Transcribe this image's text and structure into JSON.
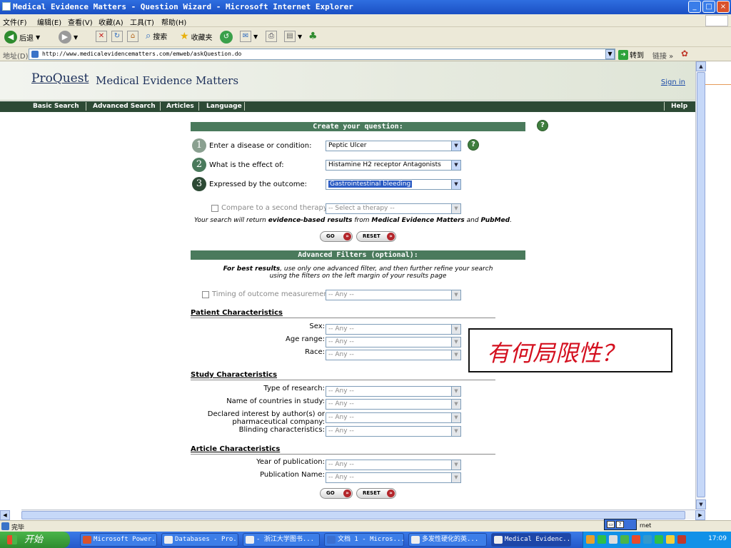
{
  "window": {
    "title": "Medical Evidence Matters - Question Wizard - Microsoft Internet Explorer",
    "controls": [
      "_",
      "□",
      "×"
    ]
  },
  "menu": [
    "文件(F)",
    "编辑(E)",
    "查看(V)",
    "收藏(A)",
    "工具(T)",
    "帮助(H)"
  ],
  "toolbar": {
    "back": "后退",
    "search": "搜索",
    "favorites": "收藏夹"
  },
  "address": {
    "label": "地址(D)",
    "url": "http://www.medicalevidencematters.com/emweb/askQuestion.do",
    "go": "转到",
    "links": "链接 »"
  },
  "site": {
    "logo": "ProQuest",
    "name": "Medical Evidence Matters",
    "signin": "Sign in",
    "nav": [
      "Basic Search",
      "Advanced Search",
      "Articles",
      "Language"
    ],
    "help": "Help"
  },
  "create": {
    "header": "Create your question:",
    "steps": [
      {
        "num": "1",
        "label": "Enter a disease or condition:",
        "value": "Peptic Ulcer"
      },
      {
        "num": "2",
        "label": "What is the effect of:",
        "value": "Histamine H2 receptor Antagonists"
      },
      {
        "num": "3",
        "label": "Expressed by the outcome:",
        "value": "Gastrointestinal bleeding"
      }
    ],
    "compare_label": "Compare to a second therapy:",
    "compare_value": "-- Select a therapy --",
    "note_pre": "Your search will return ",
    "note_bold": "evidence-based results",
    "note_mid": " from ",
    "note_src1": "Medical Evidence Matters",
    "note_and": " and ",
    "note_src2": "PubMed",
    "note_end": ".",
    "go": "GO",
    "reset": "RESET"
  },
  "filters": {
    "header": "Advanced Filters (optional):",
    "best_bold": "For best results",
    "best_line1": ", use only one advanced filter, and then further refine your search",
    "best_line2": "using the filters on the left margin of your results page",
    "timing_label": "Timing of outcome measurement:",
    "any": "-- Any --",
    "patient_header": "Patient Characteristics",
    "patient": [
      "Sex:",
      "Age range:",
      "Race:"
    ],
    "study_header": "Study Characteristics",
    "study": [
      "Type of research:",
      "Name of countries in study:",
      "Declared interest by author(s) or",
      "pharmaceutical company:",
      "Blinding characteristics:"
    ],
    "article_header": "Article Characteristics",
    "article": [
      "Year of publication:",
      "Publication Name:"
    ]
  },
  "overlay_text": "有何局限性？",
  "status": {
    "text": "完毕",
    "zone": "rnet"
  },
  "taskbar": {
    "start": "开始",
    "tasks": [
      "Microsoft Power...",
      "Databases - Pro...",
      "- 浙江大学图书...",
      "文档 1 - Micros...",
      "多发性硬化的英...",
      "Medical Evidenc..."
    ],
    "clock": "17:09"
  },
  "colors": {
    "section": "#4a7a5c",
    "nav": "#2d4a35",
    "overlay_text": "#d4101f",
    "highlight": "#2c5cc4"
  }
}
